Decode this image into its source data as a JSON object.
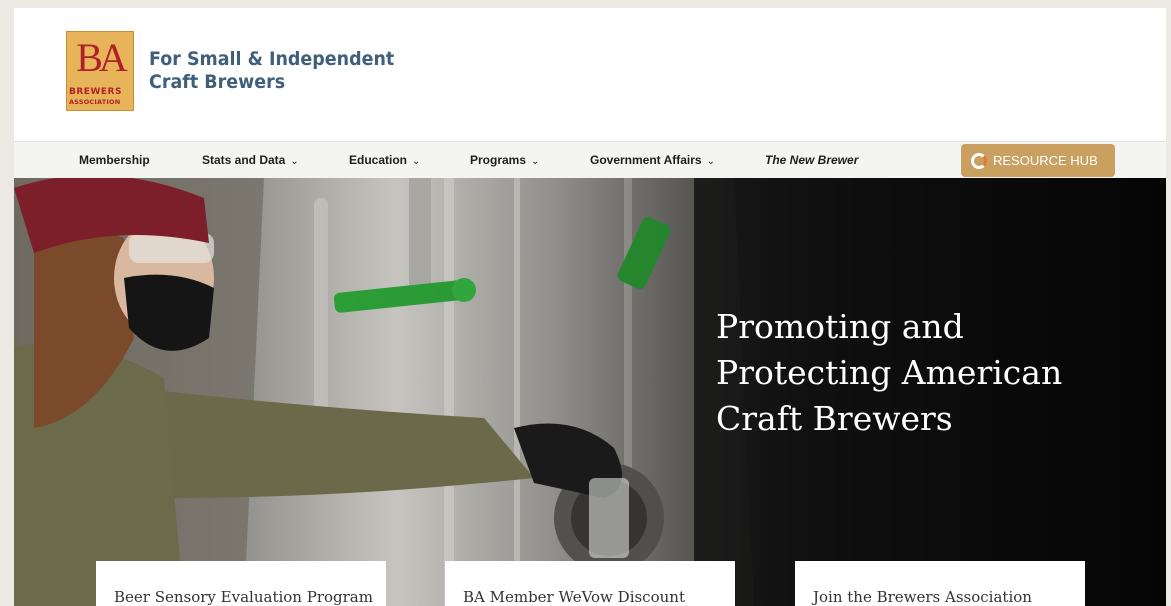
{
  "header": {
    "logo": {
      "letters": "BA",
      "line1": "BREWERS",
      "line2": "ASSOCIATION"
    },
    "tagline_line1": "For Small & Independent",
    "tagline_line2": "Craft Brewers"
  },
  "nav": {
    "items": [
      {
        "label": "Membership",
        "dropdown": false
      },
      {
        "label": "Stats and Data",
        "dropdown": true
      },
      {
        "label": "Education",
        "dropdown": true
      },
      {
        "label": "Programs",
        "dropdown": true
      },
      {
        "label": "Government Affairs",
        "dropdown": true
      },
      {
        "label": "The New Brewer",
        "dropdown": false
      }
    ],
    "chevron": "⌄",
    "resource_button": {
      "label": "RESOURCE HUB",
      "icon": "ring-icon"
    }
  },
  "hero": {
    "title_line1": "Promoting and",
    "title_line2": "Protecting American",
    "title_line3": "Craft Brewers"
  },
  "cards": [
    {
      "title": "Beer Sensory Evaluation Program"
    },
    {
      "title": "BA Member WeVow Discount"
    },
    {
      "title": "Join the Brewers Association"
    }
  ],
  "colors": {
    "accent": "#c9a060",
    "tagline": "#3f5f7a",
    "logo_bg": "#e8b45a",
    "logo_red": "#b0202a",
    "hero_bg": "#141414"
  }
}
